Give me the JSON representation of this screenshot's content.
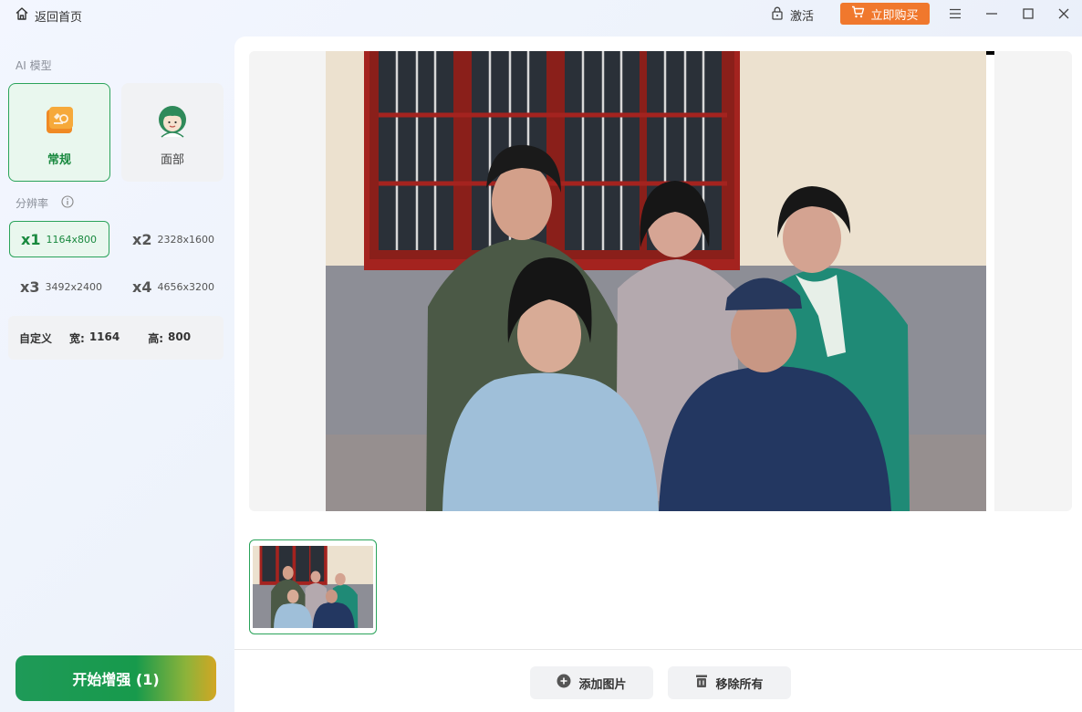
{
  "titlebar": {
    "back_label": "返回首页",
    "activate_label": "激活",
    "buy_label": "立即购买",
    "buy_color": "#f0782d"
  },
  "sidebar": {
    "ai_model_label": "AI 模型",
    "models": [
      {
        "label": "常规",
        "icon": "enhance-general-icon",
        "selected": true
      },
      {
        "label": "面部",
        "icon": "face-portrait-icon",
        "selected": false
      }
    ],
    "resolution_label": "分辨率",
    "resolutions": [
      {
        "scale": "x1",
        "size": "1164x800",
        "selected": true
      },
      {
        "scale": "x2",
        "size": "2328x1600",
        "selected": false
      },
      {
        "scale": "x3",
        "size": "3492x2400",
        "selected": false
      },
      {
        "scale": "x4",
        "size": "4656x3200",
        "selected": false
      }
    ],
    "custom": {
      "label": "自定义",
      "width_label": "宽:",
      "width_value": "1164",
      "height_label": "高:",
      "height_value": "800"
    },
    "start_button": "开始增强 (1)",
    "accent_color": "#19893f"
  },
  "main": {
    "add_button": "添加图片",
    "remove_button": "移除所有"
  }
}
